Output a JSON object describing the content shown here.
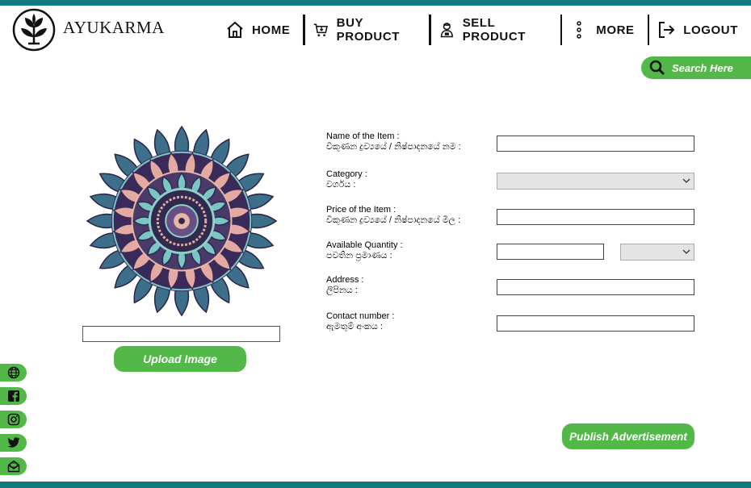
{
  "app": {
    "brand": "AYUKARMA"
  },
  "nav": {
    "home": "HOME",
    "buy": "BUY PRODUCT",
    "sell": "SELL PRODUCT",
    "more": "MORE",
    "logout": "LOGOUT"
  },
  "search": {
    "label": "Search Here"
  },
  "upload": {
    "button": "Upload Image",
    "file_value": ""
  },
  "form": {
    "name": {
      "label_en": "Name of the Item :",
      "label_si": "විකුණන ද්‍රව්‍යයේ / නිෂ්පාදනයේ නම :",
      "value": ""
    },
    "category": {
      "label_en": "Category :",
      "label_si": "වර්ගය :",
      "selected": ""
    },
    "price": {
      "label_en": "Price of the Item :",
      "label_si": "විකුණන ද්‍රව්‍යයේ / නිෂ්පාදනයේ මිල :",
      "value": ""
    },
    "quantity": {
      "label_en": "Available Quantity :",
      "label_si": "පවතින ප්‍රමාණය :",
      "value": "",
      "unit_selected": ""
    },
    "address": {
      "label_en": "Address :",
      "label_si": "ලිපිනය :",
      "value": ""
    },
    "contact": {
      "label_en": "Contact number :",
      "label_si": "ඇමතුම් අංකය :",
      "value": ""
    }
  },
  "publish": {
    "button": "Publish Advertisement"
  },
  "social": [
    "globe-icon",
    "facebook-icon",
    "instagram-icon",
    "twitter-icon",
    "mail-icon"
  ],
  "colors": {
    "accent_green": "#52b848",
    "bar_teal": "#0f7a80"
  }
}
